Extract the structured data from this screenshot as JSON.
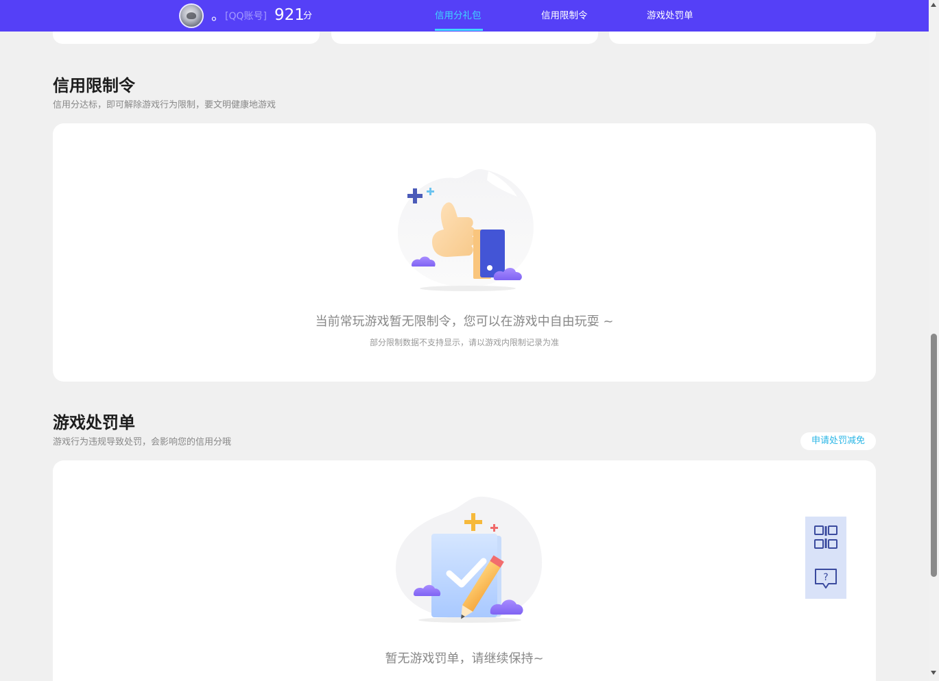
{
  "header": {
    "nickname": "。",
    "account_type": "[QQ账号]",
    "score": "921",
    "score_unit": "分",
    "tabs": [
      {
        "label": "信用分礼包",
        "active": true
      },
      {
        "label": "信用限制令",
        "active": false
      },
      {
        "label": "游戏处罚单",
        "active": false
      }
    ],
    "bar_color": "#5540f7",
    "active_color": "#3fd7ff"
  },
  "restriction": {
    "title": "信用限制令",
    "subtitle": "信用分达标，即可解除游戏行为限制，要文明健康地游戏",
    "empty_text": "当前常玩游戏暂无限制令，您可以在游戏中自由玩耍 ~",
    "note": "部分限制数据不支持显示，请以游戏内限制记录为准",
    "illustration_icon": "thumbs-up-icon"
  },
  "penalty": {
    "title": "游戏处罚单",
    "subtitle": "游戏行为违规导致处罚，会影响您的信用分哦",
    "apply_button": "申请处罚减免",
    "empty_text": "暂无游戏罚单，请继续保持~",
    "illustration_icon": "checklist-pencil-icon"
  },
  "float_tools": [
    {
      "icon": "qr-code-icon"
    },
    {
      "icon": "help-chat-icon"
    }
  ]
}
